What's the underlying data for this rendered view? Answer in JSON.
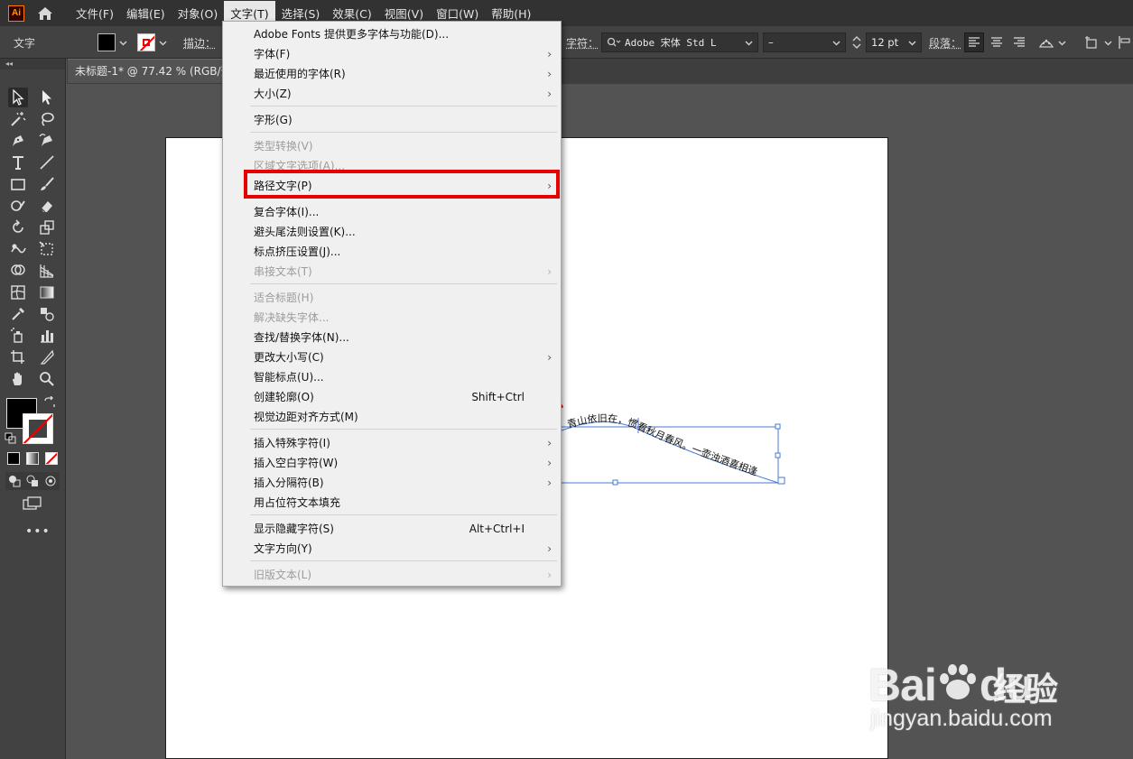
{
  "app": {
    "logo_text": "Ai"
  },
  "menubar": {
    "items": [
      "文件(F)",
      "编辑(E)",
      "对象(O)",
      "文字(T)",
      "选择(S)",
      "效果(C)",
      "视图(V)",
      "窗口(W)",
      "帮助(H)"
    ],
    "active_index": 3
  },
  "controlbar": {
    "tool_name": "文字",
    "stroke_label": "描边：",
    "char_label": "字符：",
    "font_name": "Adobe 宋体 Std L",
    "font_style": "–",
    "font_size": "12 pt",
    "para_label": "段落："
  },
  "document": {
    "tab_title": "未标题-1* @ 77.42 % (RGB/预"
  },
  "type_menu": {
    "items": [
      {
        "label": "Adobe Fonts 提供更多字体与功能(D)...",
        "disabled": false,
        "submenu": false,
        "shortcut": ""
      },
      {
        "label": "字体(F)",
        "disabled": false,
        "submenu": true,
        "shortcut": ""
      },
      {
        "label": "最近使用的字体(R)",
        "disabled": false,
        "submenu": true,
        "shortcut": ""
      },
      {
        "label": "大小(Z)",
        "disabled": false,
        "submenu": true,
        "shortcut": ""
      },
      {
        "label": "字形(G)",
        "disabled": false,
        "submenu": false,
        "shortcut": ""
      },
      {
        "label": "类型转换(V)",
        "disabled": true,
        "submenu": false,
        "shortcut": ""
      },
      {
        "label": "区域文字选项(A)...",
        "disabled": true,
        "submenu": false,
        "shortcut": ""
      },
      {
        "label": "路径文字(P)",
        "disabled": false,
        "submenu": true,
        "shortcut": ""
      },
      {
        "label": "复合字体(I)...",
        "disabled": false,
        "submenu": false,
        "shortcut": ""
      },
      {
        "label": "避头尾法则设置(K)...",
        "disabled": false,
        "submenu": false,
        "shortcut": ""
      },
      {
        "label": "标点挤压设置(J)...",
        "disabled": false,
        "submenu": false,
        "shortcut": ""
      },
      {
        "label": "串接文本(T)",
        "disabled": true,
        "submenu": true,
        "shortcut": ""
      },
      {
        "label": "适合标题(H)",
        "disabled": true,
        "submenu": false,
        "shortcut": ""
      },
      {
        "label": "解决缺失字体...",
        "disabled": true,
        "submenu": false,
        "shortcut": ""
      },
      {
        "label": "查找/替换字体(N)...",
        "disabled": false,
        "submenu": false,
        "shortcut": ""
      },
      {
        "label": "更改大小写(C)",
        "disabled": false,
        "submenu": true,
        "shortcut": ""
      },
      {
        "label": "智能标点(U)...",
        "disabled": false,
        "submenu": false,
        "shortcut": ""
      },
      {
        "label": "创建轮廓(O)",
        "disabled": false,
        "submenu": false,
        "shortcut": "Shift+Ctrl"
      },
      {
        "label": "视觉边距对齐方式(M)",
        "disabled": false,
        "submenu": false,
        "shortcut": ""
      },
      {
        "label": "插入特殊字符(I)",
        "disabled": false,
        "submenu": true,
        "shortcut": ""
      },
      {
        "label": "插入空白字符(W)",
        "disabled": false,
        "submenu": true,
        "shortcut": ""
      },
      {
        "label": "插入分隔符(B)",
        "disabled": false,
        "submenu": true,
        "shortcut": ""
      },
      {
        "label": "用占位符文本填充",
        "disabled": false,
        "submenu": false,
        "shortcut": ""
      },
      {
        "label": "显示隐藏字符(S)",
        "disabled": false,
        "submenu": false,
        "shortcut": "Alt+Ctrl+I"
      },
      {
        "label": "文字方向(Y)",
        "disabled": false,
        "submenu": true,
        "shortcut": ""
      },
      {
        "label": "旧版文本(L)",
        "disabled": true,
        "submenu": true,
        "shortcut": ""
      }
    ],
    "highlighted_item": "路径文字(P)"
  },
  "canvas": {
    "path_text": "青山依旧在，惯看秋月春风。一壶浊酒喜相逢"
  },
  "annotation": {
    "color": "#e60000",
    "arrow_icon": "red-arrow-icon"
  },
  "watermark": {
    "brand_a": "Bai",
    "brand_b": "du",
    "brand_c": "经验",
    "url": "jingyan.baidu.com"
  }
}
